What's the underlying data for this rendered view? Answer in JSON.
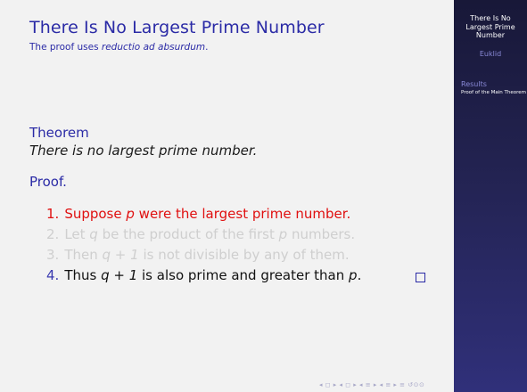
{
  "frame": {
    "title": "There Is No Largest Prime Number",
    "subtitle_prefix": "The proof uses ",
    "subtitle_emph": "reductio ad absurdum",
    "subtitle_suffix": "."
  },
  "theorem": {
    "title": "Theorem",
    "body": "There is no largest prime number."
  },
  "proof": {
    "title": "Proof.",
    "items": [
      {
        "num": "1.",
        "parts": [
          "Suppose ",
          "p",
          " were the largest prime number."
        ]
      },
      {
        "num": "2.",
        "parts": [
          "Let ",
          "q",
          " be the product of the first ",
          "p",
          " numbers."
        ]
      },
      {
        "num": "3.",
        "parts": [
          "Then ",
          "q + 1",
          " is not divisible by any of them."
        ]
      },
      {
        "num": "4.",
        "parts": [
          "Thus ",
          "q + 1",
          " is also prime and greater than ",
          "p",
          "."
        ]
      }
    ]
  },
  "navigation": {
    "symbols": "◂ ◻ ▸ ◂ ◻ ▸ ◂ ≡ ▸ ◂ ≡ ▸   ≡   ↺⊙⊙"
  },
  "sidebar": {
    "title_line1": "There Is No",
    "title_line2": "Largest Prime",
    "title_line3": "Number",
    "author": "Euklid",
    "section": "Results",
    "subsection": "Proof of the Main Theorem"
  },
  "colors": {
    "structure": "#2b2ba6",
    "alert": "#e01010",
    "faded": "#cfcfcf",
    "sidebar_top": "#181838",
    "sidebar_bottom": "#30307a"
  }
}
